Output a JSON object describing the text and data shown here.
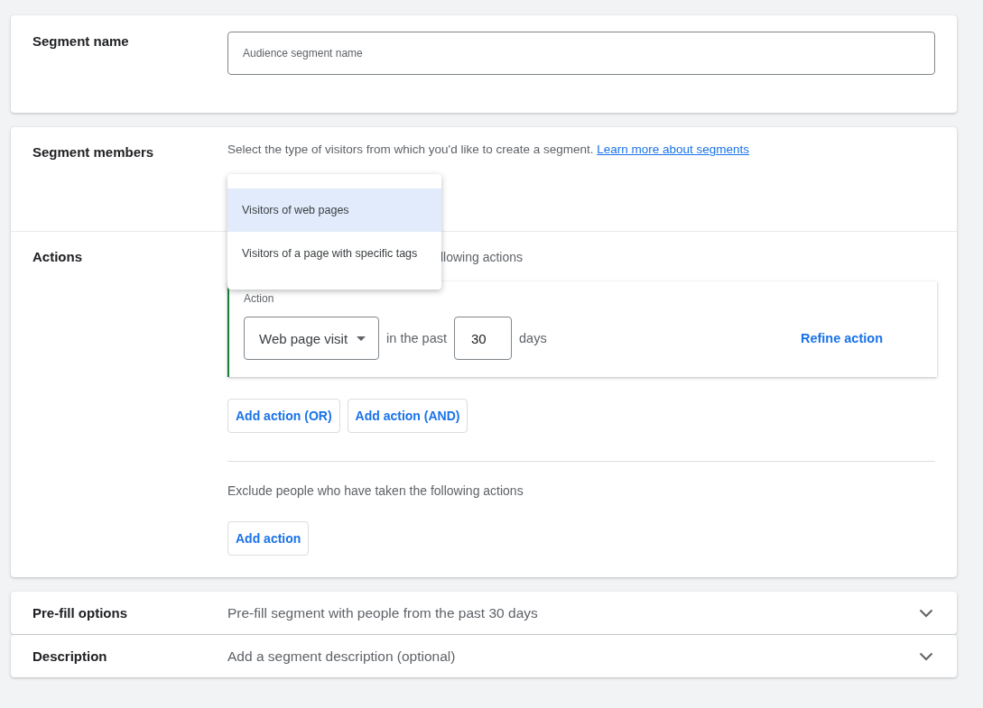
{
  "segment_name": {
    "label": "Segment name",
    "placeholder": "Audience segment name"
  },
  "segment_members": {
    "label": "Segment members",
    "intro": "Select the type of visitors from which you'd like to create a segment.",
    "link": "Learn more about segments",
    "menu": {
      "options": [
        {
          "label": "Visitors of web pages",
          "selected": true
        },
        {
          "label": "Visitors of a page with specific tags",
          "selected": false
        }
      ]
    }
  },
  "actions": {
    "label": "Actions",
    "include_text": "llowing actions",
    "action": {
      "label": "Action",
      "type": "Web page visit",
      "in_the_past": "in the past",
      "days_value": "30",
      "days": "days",
      "refine": "Refine action"
    },
    "add_buttons": [
      "Add action (OR)",
      "Add action (AND)"
    ],
    "exclude_text": "Exclude people who have taken the following actions",
    "exclude_button": "Add action"
  },
  "collapsed_sections": [
    {
      "label": "Pre-fill options",
      "summary": "Pre-fill segment with people from the past 30 days",
      "expanded": false
    },
    {
      "label": "Description",
      "summary": "Add a segment description (optional)",
      "expanded": false
    }
  ]
}
